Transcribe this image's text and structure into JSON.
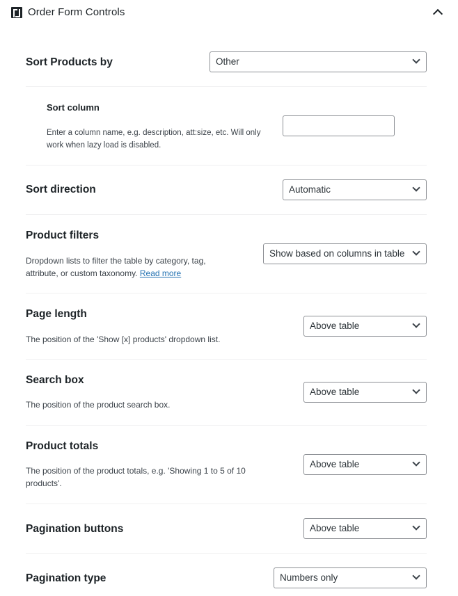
{
  "header": {
    "title": "Order Form Controls",
    "logo_icon": "plugin-logo-icon",
    "toggle_icon": "chevron-up-icon"
  },
  "sort_products": {
    "label": "Sort Products by",
    "value": "Other"
  },
  "sort_column": {
    "label": "Sort column",
    "description": "Enter a column name, e.g. description, att:size, etc. Will only work when lazy load is disabled.",
    "value": ""
  },
  "sort_direction": {
    "label": "Sort direction",
    "value": "Automatic"
  },
  "product_filters": {
    "label": "Product filters",
    "description": "Dropdown lists to filter the table by category, tag, attribute, or custom taxonomy.",
    "link": "Read more",
    "value": "Show based on columns in table"
  },
  "page_length": {
    "label": "Page length",
    "description": "The position of the 'Show [x] products' dropdown list.",
    "value": "Above table"
  },
  "search_box": {
    "label": "Search box",
    "description": "The position of the product search box.",
    "value": "Above table"
  },
  "product_totals": {
    "label": "Product totals",
    "description": "The position of the product totals, e.g. 'Showing 1 to 5 of 10 products'.",
    "value": "Above table"
  },
  "pagination_buttons": {
    "label": "Pagination buttons",
    "value": "Above table"
  },
  "pagination_type": {
    "label": "Pagination type",
    "value": "Numbers only"
  }
}
